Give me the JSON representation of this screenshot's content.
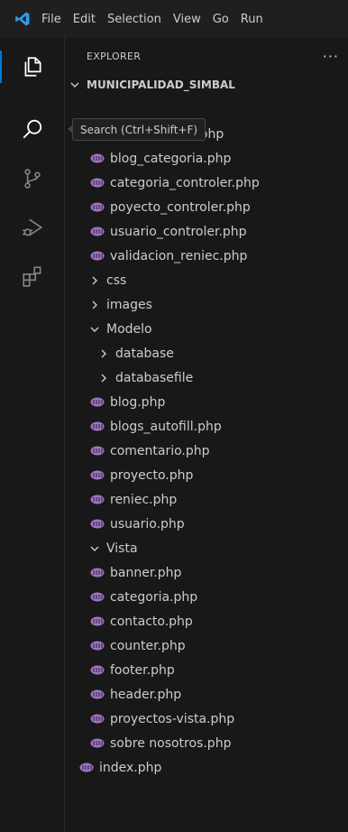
{
  "menu": {
    "items": [
      "File",
      "Edit",
      "Selection",
      "View",
      "Go",
      "Run"
    ]
  },
  "explorer": {
    "title": "EXPLORER",
    "more_label": "···",
    "root": "MUNICIPALIDAD_SIMBAL",
    "tooltip": "Search (Ctrl+Shift+F)",
    "controller_files": [
      "autenticacion.php",
      "blog_categoria.php",
      "categoria_controler.php",
      "poyecto_controler.php",
      "usuario_controler.php",
      "validacion_reniec.php"
    ],
    "folder_css": "css",
    "folder_images": "images",
    "folder_modelo": "Modelo",
    "modelo_subfolders": [
      "database",
      "databasefile"
    ],
    "modelo_files": [
      "blog.php",
      "blogs_autofill.php",
      "comentario.php",
      "proyecto.php",
      "reniec.php",
      "usuario.php"
    ],
    "folder_vista": "Vista",
    "vista_files": [
      "banner.php",
      "categoria.php",
      "contacto.php",
      "counter.php",
      "footer.php",
      "header.php",
      "proyectos-vista.php",
      "sobre nosotros.php"
    ],
    "index_file": "index.php"
  },
  "colors": {
    "accent": "#0078d4",
    "php_icon": "#a074c4",
    "background": "#181818"
  },
  "icons": {
    "activity": [
      "explorer-icon",
      "search-icon",
      "source-control-icon",
      "run-debug-icon",
      "extensions-icon"
    ]
  }
}
